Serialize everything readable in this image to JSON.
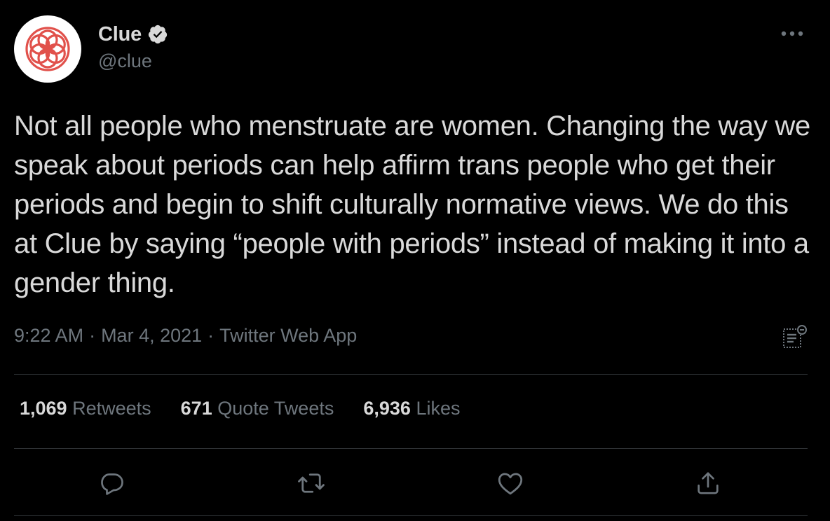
{
  "author": {
    "display_name": "Clue",
    "handle": "@clue",
    "verified": true,
    "avatar_icon": "clue-flower-logo",
    "brand_color": "#e1514b"
  },
  "tweet": {
    "text": "Not all people who menstruate are women. Changing the way we speak about periods can help affirm trans people who get their periods and begin to shift culturally normative views. We do this at Clue by saying “people with periods” instead of making it into a gender thing.",
    "time": "9:22 AM",
    "date": "Mar 4, 2021",
    "source": "Twitter Web App",
    "separator": "·"
  },
  "stats": {
    "retweets_count": "1,069",
    "retweets_label": "Retweets",
    "quotes_count": "671",
    "quotes_label": "Quote Tweets",
    "likes_count": "6,936",
    "likes_label": "Likes"
  },
  "icons": {
    "more": "more-horizontal-icon",
    "analytics": "analytics-icon",
    "reply": "reply-icon",
    "retweet": "retweet-icon",
    "like": "heart-icon",
    "share": "share-icon"
  },
  "colors": {
    "background": "#000000",
    "text_primary": "#d9d9d9",
    "text_secondary": "#6e767d",
    "divider": "#2f3336"
  }
}
